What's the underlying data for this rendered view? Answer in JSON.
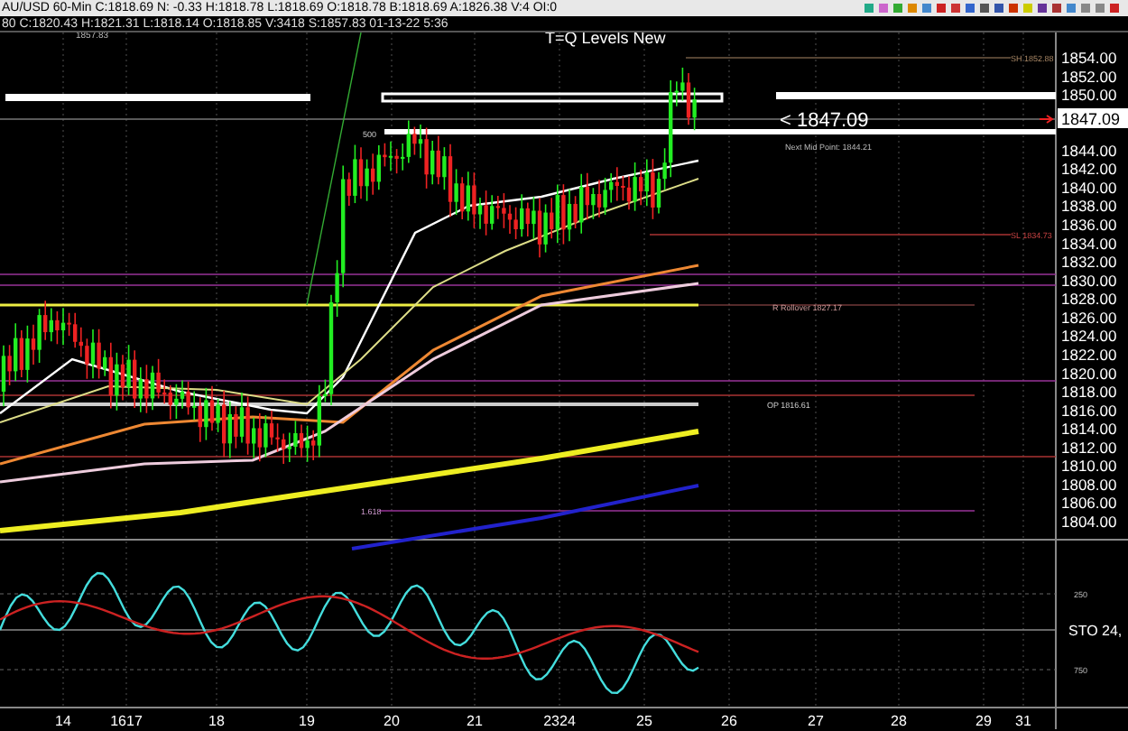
{
  "header": {
    "line_1": "AU/USD 60-Min C:1818.69 N: -0.33 H:1818.78 L:1818.69 O:1818.78 B:1818.69 A:1826.38 V:4 OI:0",
    "line_2": "80 C:1820.43 H:1821.31 L:1818.14 O:1818.85 V:3418 S:1857.83 01-13-22 5:36"
  },
  "chart": {
    "title": "T=Q Levels New",
    "corner_label": "1857.83",
    "annotations": [
      {
        "kind": "current",
        "text": "< 1847.09"
      },
      {
        "kind": "small",
        "text": "Next Mid Point: 1844.21"
      },
      {
        "kind": "small",
        "text": "SH 1852.88"
      },
      {
        "kind": "small",
        "text": "SL 1834.73"
      },
      {
        "kind": "small",
        "text": "R Rollover 1827.17"
      },
      {
        "kind": "small",
        "text": "OP 1816.61"
      },
      {
        "kind": "small",
        "text": "500"
      },
      {
        "kind": "small",
        "text": "1.618"
      }
    ],
    "price_tag": "1847.09",
    "price_axis": [
      "1854.00",
      "1852.00",
      "1850.00",
      "1844.00",
      "1842.00",
      "1840.00",
      "1838.00",
      "1836.00",
      "1834.00",
      "1832.00",
      "1830.00",
      "1828.00",
      "1826.00",
      "1824.00",
      "1822.00",
      "1820.00",
      "1818.00",
      "1816.00",
      "1814.00",
      "1812.00",
      "1810.00",
      "1808.00",
      "1806.00",
      "1804.00"
    ]
  },
  "oscillator": {
    "label": "STO  24,",
    "levels": [
      "250",
      "750"
    ]
  },
  "time_axis": [
    "14",
    "1617",
    "18",
    "19",
    "20",
    "21",
    "2324",
    "25",
    "26",
    "27",
    "28",
    "29",
    "31"
  ]
}
